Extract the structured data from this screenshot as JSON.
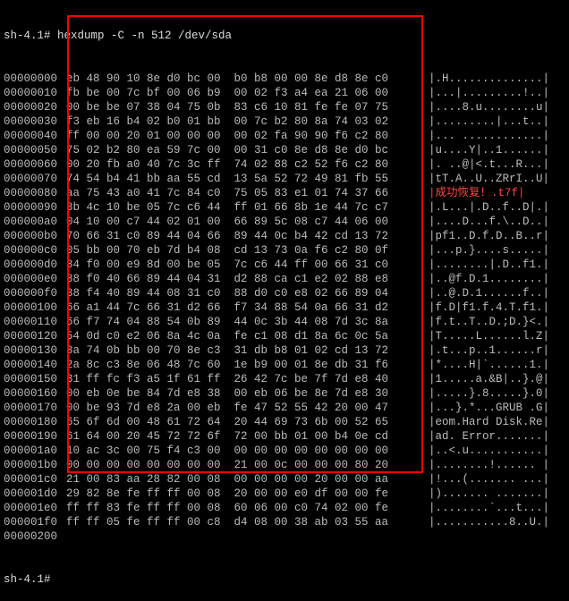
{
  "prompt_line": "sh-4.1# hexdump -C -n 512 /dev/sda",
  "end_prompt": "sh-4.1#",
  "dump": [
    {
      "o": "00000000",
      "h": "eb 48 90 10 8e d0 bc 00  b0 b8 00 00 8e d8 8e c0",
      "a": "|.H..............|"
    },
    {
      "o": "00000010",
      "h": "fb be 00 7c bf 00 06 b9  00 02 f3 a4 ea 21 06 00",
      "a": "|...|.........!..|"
    },
    {
      "o": "00000020",
      "h": "00 be be 07 38 04 75 0b  83 c6 10 81 fe fe 07 75",
      "a": "|....8.u........u|"
    },
    {
      "o": "00000030",
      "h": "f3 eb 16 b4 02 b0 01 bb  00 7c b2 80 8a 74 03 02",
      "a": "|.........|...t..|"
    },
    {
      "o": "00000040",
      "h": "ff 00 00 20 01 00 00 00  00 02 fa 90 90 f6 c2 80",
      "a": "|... ............|"
    },
    {
      "o": "00000050",
      "h": "75 02 b2 80 ea 59 7c 00  00 31 c0 8e d8 8e d0 bc",
      "a": "|u....Y|..1......|"
    },
    {
      "o": "00000060",
      "h": "00 20 fb a0 40 7c 3c ff  74 02 88 c2 52 f6 c2 80",
      "a": "|. ..@|<.t...R...|"
    },
    {
      "o": "00000070",
      "h": "74 54 b4 41 bb aa 55 cd  13 5a 52 72 49 81 fb 55",
      "a": "|tT.A..U..ZRrI..U|"
    },
    {
      "o": "00000080",
      "h": "aa 75 43 a0 41 7c 84 c0  75 05 83 e1 01 74 37 66",
      "a": "|成功恢复！.t7f|",
      "red": true
    },
    {
      "o": "00000090",
      "h": "8b 4c 10 be 05 7c c6 44  ff 01 66 8b 1e 44 7c c7",
      "a": "|.L...|.D..f..D|.|"
    },
    {
      "o": "000000a0",
      "h": "04 10 00 c7 44 02 01 00  66 89 5c 08 c7 44 06 00",
      "a": "|....D...f.\\..D..|"
    },
    {
      "o": "000000b0",
      "h": "70 66 31 c0 89 44 04 66  89 44 0c b4 42 cd 13 72",
      "a": "|pf1..D.f.D..B..r|"
    },
    {
      "o": "000000c0",
      "h": "05 bb 00 70 eb 7d b4 08  cd 13 73 0a f6 c2 80 0f",
      "a": "|...p.}....s.....|"
    },
    {
      "o": "000000d0",
      "h": "84 f0 00 e9 8d 00 be 05  7c c6 44 ff 00 66 31 c0",
      "a": "|........|.D..f1.|"
    },
    {
      "o": "000000e0",
      "h": "88 f0 40 66 89 44 04 31  d2 88 ca c1 e2 02 88 e8",
      "a": "|..@f.D.1........|"
    },
    {
      "o": "000000f0",
      "h": "88 f4 40 89 44 08 31 c0  88 d0 c0 e8 02 66 89 04",
      "a": "|..@.D.1......f..|"
    },
    {
      "o": "00000100",
      "h": "66 a1 44 7c 66 31 d2 66  f7 34 88 54 0a 66 31 d2",
      "a": "|f.D|f1.f.4.T.f1.|"
    },
    {
      "o": "00000110",
      "h": "66 f7 74 04 88 54 0b 89  44 0c 3b 44 08 7d 3c 8a",
      "a": "|f.t..T..D.;D.}<.|"
    },
    {
      "o": "00000120",
      "h": "54 0d c0 e2 06 8a 4c 0a  fe c1 08 d1 8a 6c 0c 5a",
      "a": "|T.....L......l.Z|"
    },
    {
      "o": "00000130",
      "h": "8a 74 0b bb 00 70 8e c3  31 db b8 01 02 cd 13 72",
      "a": "|.t...p..1......r|"
    },
    {
      "o": "00000140",
      "h": "2a 8c c3 8e 06 48 7c 60  1e b9 00 01 8e db 31 f6",
      "a": "|*....H|`......1.|"
    },
    {
      "o": "00000150",
      "h": "31 ff fc f3 a5 1f 61 ff  26 42 7c be 7f 7d e8 40",
      "a": "|1.....a.&B|..}.@|"
    },
    {
      "o": "00000160",
      "h": "00 eb 0e be 84 7d e8 38  00 eb 06 be 8e 7d e8 30",
      "a": "|.....}.8.....}.0|"
    },
    {
      "o": "00000170",
      "h": "00 be 93 7d e8 2a 00 eb  fe 47 52 55 42 20 00 47",
      "a": "|...}.*...GRUB .G|"
    },
    {
      "o": "00000180",
      "h": "65 6f 6d 00 48 61 72 64  20 44 69 73 6b 00 52 65",
      "a": "|eom.Hard Disk.Re|"
    },
    {
      "o": "00000190",
      "h": "61 64 00 20 45 72 72 6f  72 00 bb 01 00 b4 0e cd",
      "a": "|ad. Error.......|"
    },
    {
      "o": "000001a0",
      "h": "10 ac 3c 00 75 f4 c3 00  00 00 00 00 00 00 00 00",
      "a": "|..<.u...........|"
    },
    {
      "o": "000001b0",
      "h": "00 00 00 00 00 00 00 00  21 00 0c 00 00 00 80 20",
      "a": "|........!...... |"
    },
    {
      "o": "000001c0",
      "h": "21 00 83 aa 28 82 00 08  00 00 00 00 20 00 00 aa",
      "a": "|!...(....... ...|"
    },
    {
      "o": "000001d0",
      "h": "29 82 8e fe ff ff 00 08  20 00 00 e0 df 00 00 fe",
      "a": "|)....... .......|"
    },
    {
      "o": "000001e0",
      "h": "ff ff 83 fe ff ff 00 08  60 06 00 c0 74 02 00 fe",
      "a": "|........`...t...|"
    },
    {
      "o": "000001f0",
      "h": "ff ff 05 fe ff ff 00 c8  d4 08 00 38 ab 03 55 aa",
      "a": "|...........8..U.|"
    },
    {
      "o": "00000200",
      "h": "",
      "a": ""
    }
  ]
}
